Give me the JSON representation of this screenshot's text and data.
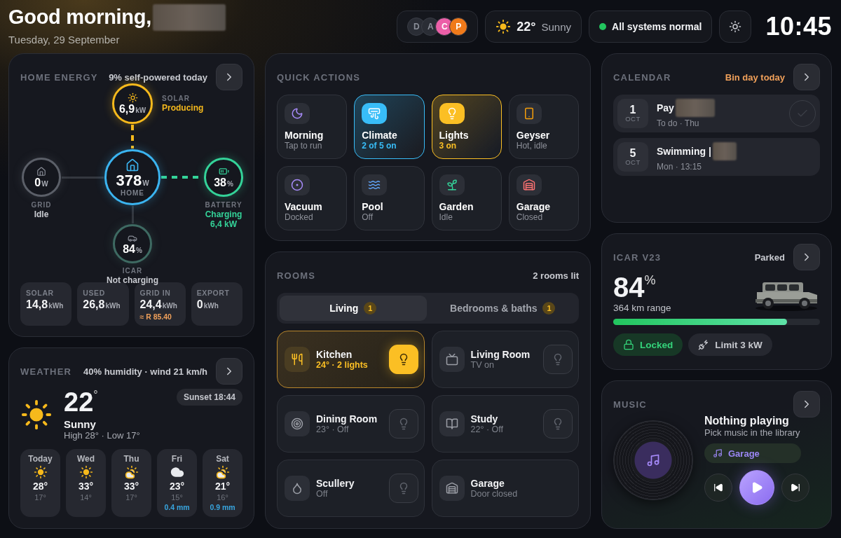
{
  "header": {
    "greeting": "Good morning,",
    "redacted": true,
    "date": "Tuesday, 29 September",
    "avatars": [
      {
        "initial": "D",
        "color": "#2a2d35"
      },
      {
        "initial": "A",
        "color": "#2a2d35"
      },
      {
        "initial": "C",
        "color": "#ec5fa8"
      },
      {
        "initial": "P",
        "color": "#f07a1a"
      }
    ],
    "weather": {
      "temp": "22°",
      "condition": "Sunny"
    },
    "status": {
      "text": "All systems normal",
      "color": "#22c55e"
    },
    "clock": "10:45"
  },
  "energy": {
    "title": "HOME ENERGY",
    "summary": "9% self-powered today",
    "nodes": [
      {
        "kind": "solar",
        "value": "6,9",
        "unit": "kW",
        "label": "SOLAR",
        "status": "Producing",
        "active": true
      },
      {
        "kind": "grid",
        "value": "0",
        "unit": "W",
        "label": "GRID",
        "status": "Idle",
        "active": false
      },
      {
        "kind": "home",
        "value": "378",
        "unit": "W",
        "label": "HOME"
      },
      {
        "kind": "battery",
        "value": "38",
        "unit": "%",
        "label": "BATTERY",
        "status": "Charging",
        "detail": "6,4 kW",
        "active": true
      },
      {
        "kind": "car",
        "value": "84",
        "unit": "%",
        "label": "ICAR",
        "status": "Not charging",
        "active": false
      }
    ],
    "stats": [
      {
        "label": "SOLAR",
        "value": "14,8",
        "unit": "kWh"
      },
      {
        "label": "USED",
        "value": "26,8",
        "unit": "kWh"
      },
      {
        "label": "GRID IN",
        "value": "24,4",
        "unit": "kWh",
        "note": "≈ R 85.40"
      },
      {
        "label": "EXPORT",
        "value": "0",
        "unit": "kWh"
      }
    ]
  },
  "weather": {
    "title": "WEATHER",
    "summary": "40% humidity · wind 21 km/h",
    "temp": "22",
    "temp_unit": "°",
    "condition": "Sunny",
    "range": "High 28° · Low 17°",
    "sunset": "Sunset 18:44",
    "forecast": [
      {
        "day": "Today",
        "kind": "sunny",
        "high": "28°",
        "low": "17°"
      },
      {
        "day": "Wed",
        "kind": "sunny",
        "high": "33°",
        "low": "14°"
      },
      {
        "day": "Thu",
        "kind": "partly",
        "high": "33°",
        "low": "17°"
      },
      {
        "day": "Fri",
        "kind": "cloudy",
        "high": "23°",
        "low": "15°",
        "rain": "0.4 mm"
      },
      {
        "day": "Sat",
        "kind": "partly",
        "high": "21°",
        "low": "16°",
        "rain": "0.9 mm"
      }
    ]
  },
  "quick_actions": {
    "title": "QUICK ACTIONS",
    "items": [
      {
        "label": "Morning",
        "status": "Tap to run",
        "on": false,
        "color": "#a78bfa"
      },
      {
        "label": "Climate",
        "status": "2 of 5 on",
        "on": true,
        "color": "#38bdf8"
      },
      {
        "label": "Lights",
        "status": "3 on",
        "on": true,
        "color": "#fbbf24"
      },
      {
        "label": "Geyser",
        "status": "Hot, idle",
        "on": false,
        "color": "#f59e0b"
      },
      {
        "label": "Vacuum",
        "status": "Docked",
        "on": false,
        "color": "#a78bfa"
      },
      {
        "label": "Pool",
        "status": "Off",
        "on": false,
        "color": "#60a5fa"
      },
      {
        "label": "Garden",
        "status": "Idle",
        "on": false,
        "color": "#34d399"
      },
      {
        "label": "Garage",
        "status": "Closed",
        "on": false,
        "color": "#f87171"
      }
    ]
  },
  "rooms": {
    "title": "ROOMS",
    "summary": "2 rooms lit",
    "tabs": [
      {
        "label": "Living",
        "count": "1",
        "selected": true
      },
      {
        "label": "Bedrooms & baths",
        "count": "1",
        "selected": false
      }
    ],
    "items": [
      {
        "name": "Kitchen",
        "detail": "24° · 2 lights",
        "kind": "lamp",
        "lit": true
      },
      {
        "name": "Living Room",
        "detail": "TV on",
        "kind": "lamp",
        "lit": false
      },
      {
        "name": "Dining Room",
        "detail": "23° · Off",
        "kind": "lamp",
        "lit": false
      },
      {
        "name": "Study",
        "detail": "22° · Off",
        "kind": "lamp",
        "lit": false
      },
      {
        "name": "Scullery",
        "detail": "Off",
        "kind": "lamp",
        "lit": false
      },
      {
        "name": "Garage",
        "detail": "Door closed",
        "kind": "door",
        "lit": false
      }
    ]
  },
  "calendar": {
    "title": "CALENDAR",
    "note": "Bin day today",
    "events": [
      {
        "day": "1",
        "month": "OCT",
        "title": "Pay",
        "redacted": true,
        "sub": "To do · Thu",
        "kind": "todo",
        "checked": false
      },
      {
        "day": "5",
        "month": "OCT",
        "title": "Swimming |",
        "redacted": true,
        "sub": "Mon · 13:15",
        "kind": "event"
      }
    ]
  },
  "car": {
    "title": "ICAR V23",
    "status": "Parked",
    "charge": "84",
    "charge_unit": "%",
    "range": "364 km range",
    "level": 0.84,
    "chips": [
      {
        "label": "Locked",
        "kind": "lock",
        "active": true
      },
      {
        "label": "Limit 3 kW",
        "kind": "limit",
        "active": false
      }
    ]
  },
  "music": {
    "title": "MUSIC",
    "track": "Nothing playing",
    "hint": "Pick music in the library",
    "speaker": "Garage",
    "playing": false
  }
}
